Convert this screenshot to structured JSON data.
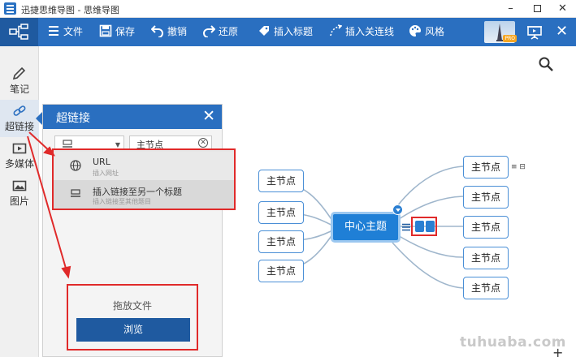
{
  "window": {
    "title": "迅捷思维导图 - 思维导图",
    "min": "–",
    "close": "✕"
  },
  "toolbar": {
    "file": "文件",
    "save": "保存",
    "undo": "撤销",
    "redo": "还原",
    "insert_title": "插入标题",
    "insert_link": "插入关连线",
    "style": "风格",
    "avatar_badge": "PRO",
    "close": "✕"
  },
  "sidebar": {
    "items": [
      {
        "label": "笔记",
        "icon": "pencil-icon"
      },
      {
        "label": "超链接",
        "icon": "link-icon"
      },
      {
        "label": "多媒体",
        "icon": "media-icon"
      },
      {
        "label": "图片",
        "icon": "image-icon"
      }
    ]
  },
  "panel": {
    "title": "超链接",
    "close": "✕",
    "target_value": "主节点",
    "clear": "✕",
    "dropdown": {
      "items": [
        {
          "main": "URL",
          "sub": "插入网址"
        },
        {
          "main": "插入链接至另一个标题",
          "sub": "插入链接至其他题目"
        }
      ]
    },
    "dropzone_label": "拖放文件",
    "browse": "浏览"
  },
  "mindmap": {
    "center": "中心主题",
    "left_nodes": [
      "主节点",
      "主节点",
      "主节点",
      "主节点"
    ],
    "right_nodes": [
      "主节点",
      "主节点",
      "主节点",
      "主节点",
      "主节点"
    ],
    "node_r1_icons": "≡ ⊟"
  },
  "watermark": "tuhuaba.com",
  "plus": "+",
  "colors": {
    "toolbar": "#2a6fc0",
    "center_node": "#1f7fd6",
    "highlight_border": "#e02a2a",
    "browse_button": "#1f5aa0"
  }
}
